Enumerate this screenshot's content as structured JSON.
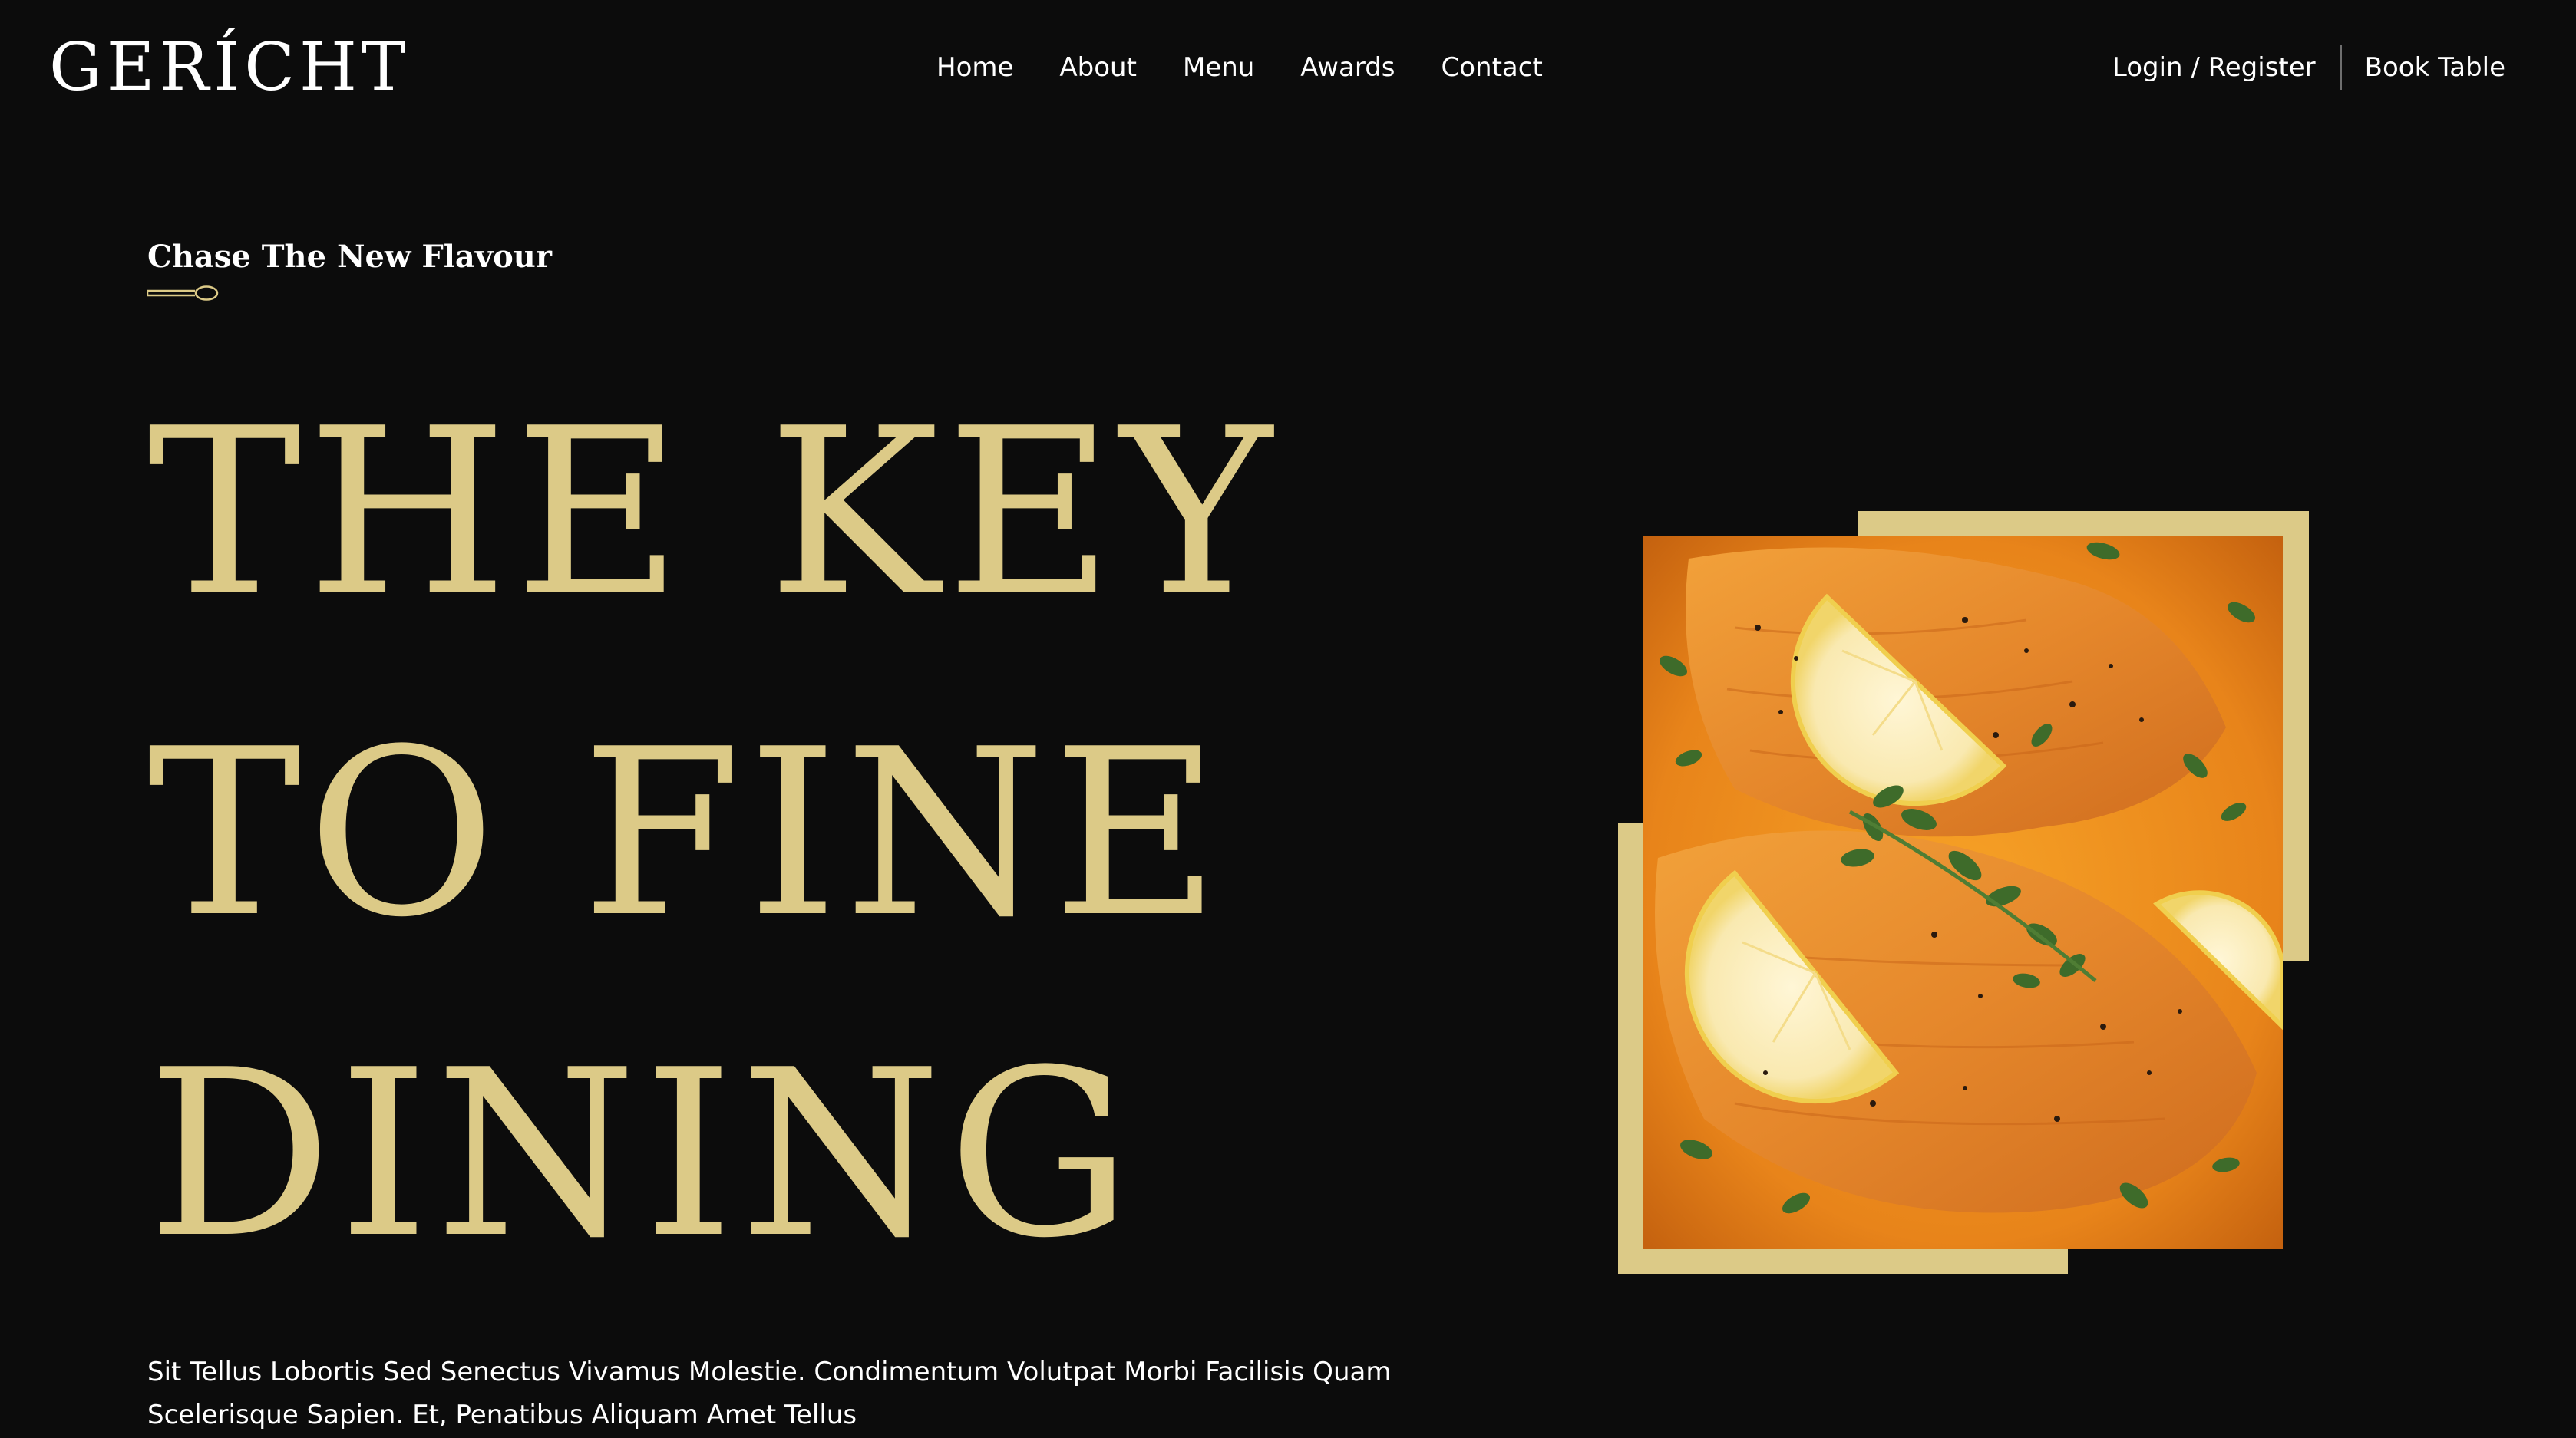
{
  "brand": {
    "logo": "GERÍCHT"
  },
  "nav": {
    "links": [
      "Home",
      "About",
      "Menu",
      "Awards",
      "Contact"
    ],
    "login_label": "Login / Register",
    "book_label": "Book Table"
  },
  "hero": {
    "subtitle": "Chase The New Flavour",
    "headline_lines": [
      "THE KEY",
      "TO FINE",
      "DINING"
    ],
    "description": "Sit Tellus Lobortis Sed Senectus Vivamus Molestie. Condimentum Volutpat Morbi Facilisis Quam Scelerisque Sapien. Et, Penatibus Aliquam Amet Tellus",
    "image_icon": "salmon-dish-photo",
    "spoon_icon": "spoon-icon"
  },
  "colors": {
    "background": "#0c0c0c",
    "gold": "#dcca87",
    "text": "#ffffff"
  }
}
